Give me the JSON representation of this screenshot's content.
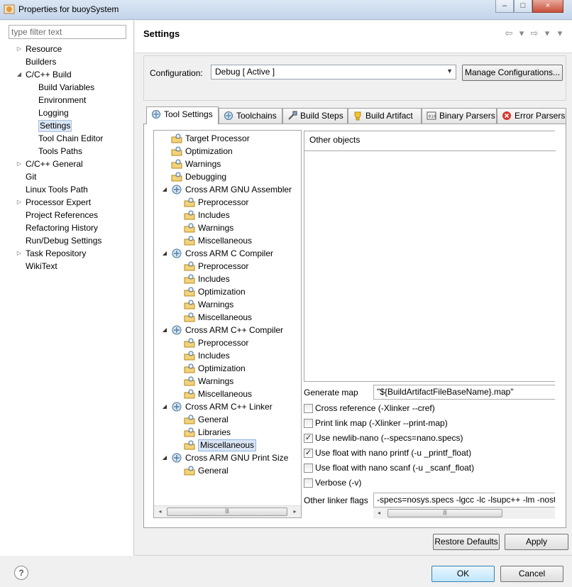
{
  "window": {
    "title": "Properties for buoySystem",
    "controls": [
      "–",
      "□",
      "×"
    ]
  },
  "left_panel": {
    "filter_placeholder": "type filter text",
    "items": [
      {
        "label": "Resource",
        "expander": "▷"
      },
      {
        "label": "Builders",
        "expander": ""
      },
      {
        "label": "C/C++ Build",
        "expander": "◢"
      },
      {
        "label": "Build Variables",
        "expander": ""
      },
      {
        "label": "Environment",
        "expander": ""
      },
      {
        "label": "Logging",
        "expander": ""
      },
      {
        "label": "Settings",
        "expander": "",
        "selected": true
      },
      {
        "label": "Tool Chain Editor",
        "expander": ""
      },
      {
        "label": "Tools Paths",
        "expander": ""
      },
      {
        "label": "C/C++ General",
        "expander": "▷"
      },
      {
        "label": "Git",
        "expander": ""
      },
      {
        "label": "Linux Tools Path",
        "expander": ""
      },
      {
        "label": "Processor Expert",
        "expander": "▷"
      },
      {
        "label": "Project References",
        "expander": ""
      },
      {
        "label": "Refactoring History",
        "expander": ""
      },
      {
        "label": "Run/Debug Settings",
        "expander": ""
      },
      {
        "label": "Task Repository",
        "expander": "▷"
      },
      {
        "label": "WikiText",
        "expander": ""
      }
    ]
  },
  "header": {
    "title": "Settings",
    "nav": [
      "⇦",
      "▾",
      "⇨",
      "▾",
      "▾"
    ]
  },
  "configuration": {
    "label": "Configuration:",
    "value": "Debug  [ Active ]",
    "manage_label": "Manage Configurations..."
  },
  "tabs": [
    {
      "label": "Tool Settings",
      "active": true
    },
    {
      "label": "Toolchains"
    },
    {
      "label": "Build Steps"
    },
    {
      "label": "Build Artifact"
    },
    {
      "label": "Binary Parsers"
    },
    {
      "label": "Error Parsers"
    }
  ],
  "tool_tree": [
    {
      "label": "Target Processor",
      "expander": ""
    },
    {
      "label": "Optimization",
      "expander": ""
    },
    {
      "label": "Warnings",
      "expander": ""
    },
    {
      "label": "Debugging",
      "expander": ""
    },
    {
      "label": "Cross ARM GNU Assembler",
      "expander": "◢"
    },
    {
      "label": "Preprocessor",
      "expander": ""
    },
    {
      "label": "Includes",
      "expander": ""
    },
    {
      "label": "Warnings",
      "expander": ""
    },
    {
      "label": "Miscellaneous",
      "expander": ""
    },
    {
      "label": "Cross ARM C Compiler",
      "expander": "◢"
    },
    {
      "label": "Preprocessor",
      "expander": ""
    },
    {
      "label": "Includes",
      "expander": ""
    },
    {
      "label": "Optimization",
      "expander": ""
    },
    {
      "label": "Warnings",
      "expander": ""
    },
    {
      "label": "Miscellaneous",
      "expander": ""
    },
    {
      "label": "Cross ARM C++ Compiler",
      "expander": "◢"
    },
    {
      "label": "Preprocessor",
      "expander": ""
    },
    {
      "label": "Includes",
      "expander": ""
    },
    {
      "label": "Optimization",
      "expander": ""
    },
    {
      "label": "Warnings",
      "expander": ""
    },
    {
      "label": "Miscellaneous",
      "expander": ""
    },
    {
      "label": "Cross ARM C++ Linker",
      "expander": "◢"
    },
    {
      "label": "General",
      "expander": ""
    },
    {
      "label": "Libraries",
      "expander": ""
    },
    {
      "label": "Miscellaneous",
      "expander": "",
      "selected": true
    },
    {
      "label": "Cross ARM GNU Print Size",
      "expander": "◢"
    },
    {
      "label": "General",
      "expander": ""
    }
  ],
  "tree_scroll": {
    "left": "◂",
    "right": "▸",
    "grip": "|||"
  },
  "linker_misc": {
    "other_objects_label": "Other objects",
    "generate_map_label": "Generate map",
    "generate_map_value": "\"${BuildArtifactFileBaseName}.map\"",
    "options": [
      {
        "label": "Cross reference (-Xlinker --cref)",
        "checked": false
      },
      {
        "label": "Print link map (-Xlinker --print-map)",
        "checked": false
      },
      {
        "label": "Use newlib-nano (--specs=nano.specs)",
        "checked": true
      },
      {
        "label": "Use float with nano printf (-u _printf_float)",
        "checked": true
      },
      {
        "label": "Use float with nano scanf (-u _scanf_float)",
        "checked": false
      },
      {
        "label": "Verbose (-v)",
        "checked": false
      }
    ],
    "other_linker_flags_label": "Other linker flags",
    "other_linker_flags_value": "-specs=nosys.specs  -lgcc -lc -lsupc++ -lm -nostartfiles",
    "scroll_left": "◂",
    "scroll_grip": "|||"
  },
  "buttons": {
    "restore_defaults": "Restore Defaults",
    "apply": "Apply",
    "ok": "OK",
    "cancel": "Cancel",
    "help": "?"
  }
}
